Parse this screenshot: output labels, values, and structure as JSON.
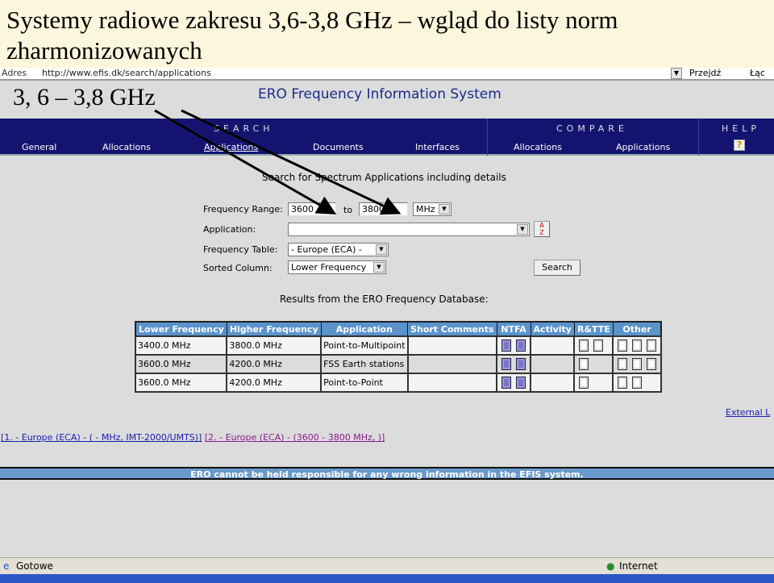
{
  "slide": {
    "title": "Systemy radiowe zakresu 3,6-3,8 GHz  – wgląd do listy norm zharmonizowanych",
    "overlay": "3, 6 – 3,8 GHz"
  },
  "browser": {
    "address_label": "Adres",
    "url": "http://www.efis.dk/search/applications",
    "go_label": "Przejdź",
    "links_label": "Łąc",
    "status": "Gotowe",
    "zone": "Internet"
  },
  "site": {
    "title": "ERO Frequency Information System"
  },
  "nav": {
    "search_heading": "SEARCH",
    "compare_heading": "COMPARE",
    "help_heading": "HELP",
    "search_items": [
      "General",
      "Allocations",
      "Applications",
      "Documents",
      "Interfaces"
    ],
    "compare_items": [
      "Allocations",
      "Applications"
    ],
    "active": "Applications"
  },
  "form": {
    "title": "Search for Spectrum Applications including details",
    "freq_label": "Frequency Range:",
    "from": "3600",
    "to_label": "to",
    "to": "3800",
    "unit": "MHz",
    "application_label": "Application:",
    "application": "",
    "table_label": "Frequency Table:",
    "table": "- Europe (ECA) -",
    "sorted_label": "Sorted Column:",
    "sorted": "Lower Frequency",
    "search_button": "Search"
  },
  "results": {
    "title": "Results from the ERO Frequency Database:",
    "columns": [
      "Lower Frequency",
      "Higher Frequency",
      "Application",
      "Short Comments",
      "NTFA",
      "Activity",
      "R&TTE",
      "Other"
    ],
    "rows": [
      {
        "lower": "3400.0 MHz",
        "higher": "3800.0 MHz",
        "application": "Point-to-Multipoint",
        "comments": "",
        "ntfa": 2,
        "rtte": 2,
        "other": 3
      },
      {
        "lower": "3600.0 MHz",
        "higher": "4200.0 MHz",
        "application": "FSS Earth stations",
        "comments": "",
        "ntfa": 2,
        "rtte": 1,
        "other": 3
      },
      {
        "lower": "3600.0 MHz",
        "higher": "4200.0 MHz",
        "application": "Point-to-Point",
        "comments": "",
        "ntfa": 2,
        "rtte": 1,
        "other": 2
      }
    ]
  },
  "external_link": "External L",
  "footnotes": [
    {
      "text": "[1. - Europe (ECA) - ( -  MHz, IMT-2000/UMTS)]",
      "color": "#1a1ab0"
    },
    {
      "text": "[2. - Europe (ECA) - (3600 - 3800 MHz, )]",
      "color": "#8a1a8a"
    }
  ],
  "disclaimer": "ERO cannot be held responsible for any wrong information in the EFIS system."
}
